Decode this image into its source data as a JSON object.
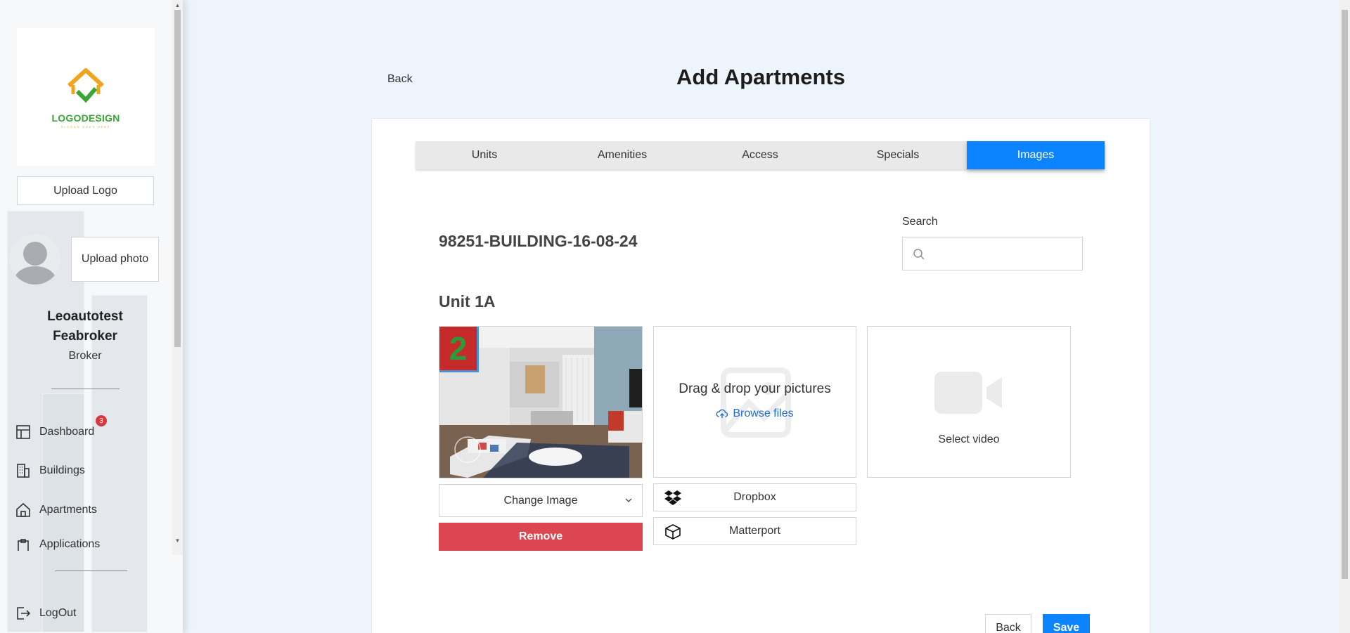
{
  "sidebar": {
    "logo_text": "LOGODESIGN",
    "logo_sub": "SLOGAN GOES HERE",
    "upload_logo_label": "Upload Logo",
    "upload_photo_label": "Upload photo",
    "user_name": "Leoautotest Feabroker",
    "user_role": "Broker",
    "nav": [
      {
        "label": "Dashboard",
        "icon": "dashboard-icon",
        "badge": "3"
      },
      {
        "label": "Buildings",
        "icon": "building-icon"
      },
      {
        "label": "Apartments",
        "icon": "home-icon"
      },
      {
        "label": "Applications",
        "icon": "clipboard-icon"
      }
    ],
    "logout_label": "LogOut"
  },
  "header": {
    "back_label": "Back",
    "title": "Add Apartments"
  },
  "tabs": [
    {
      "label": "Units",
      "active": false
    },
    {
      "label": "Amenities",
      "active": false
    },
    {
      "label": "Access",
      "active": false
    },
    {
      "label": "Specials",
      "active": false
    },
    {
      "label": "Images",
      "active": true
    }
  ],
  "content": {
    "building_name": "98251-BUILDING-16-08-24",
    "search_label": "Search",
    "search_value": "",
    "unit_title": "Unit 1A",
    "photo_number": "2",
    "change_image_label": "Change Image",
    "remove_label": "Remove",
    "drop_title": "Drag & drop your pictures",
    "browse_label": "Browse files",
    "video_label": "Select video",
    "dropbox_label": "Dropbox",
    "matterport_label": "Matterport"
  },
  "footer": {
    "back_label": "Back",
    "save_label": "Save"
  },
  "colors": {
    "accent": "#0d84ff",
    "danger": "#dc4650",
    "badge": "#d9363e",
    "link": "#1f6fd1"
  }
}
